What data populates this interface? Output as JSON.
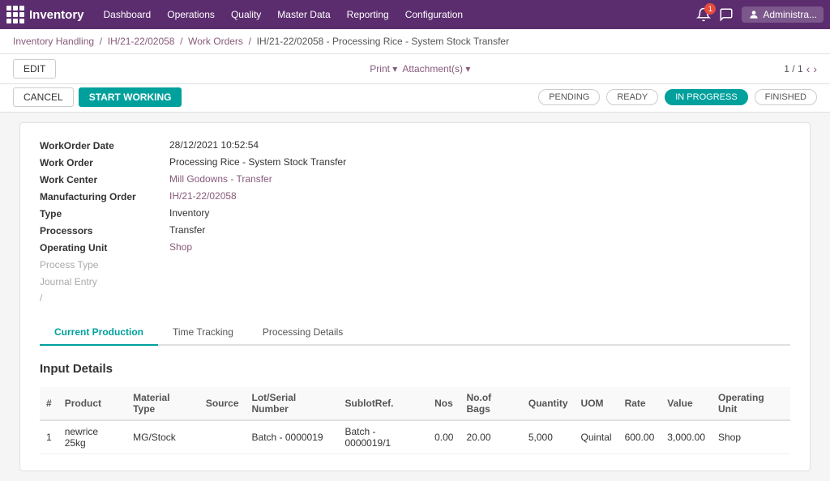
{
  "app": {
    "logo": "Inventory",
    "nav_items": [
      "Dashboard",
      "Operations",
      "Quality",
      "Master Data",
      "Reporting",
      "Configuration"
    ],
    "badge_count": "1",
    "admin_label": "Administra..."
  },
  "breadcrumb": {
    "items": [
      "Inventory Handling",
      "IH/21-22/02058",
      "Work Orders"
    ],
    "current": "IH/21-22/02058 - Processing Rice - System Stock Transfer"
  },
  "toolbar": {
    "edit_label": "EDIT",
    "cancel_label": "CANCEL",
    "start_label": "START WORKING",
    "print_label": "Print ▾",
    "attach_label": "Attachment(s) ▾",
    "counter": "1 / 1"
  },
  "status_pills": [
    {
      "label": "PENDING",
      "active": false
    },
    {
      "label": "READY",
      "active": false
    },
    {
      "label": "IN PROGRESS",
      "active": true
    },
    {
      "label": "FINISHED",
      "active": false
    }
  ],
  "form": {
    "workorder_date_label": "WorkOrder Date",
    "workorder_date_value": "28/12/2021 10:52:54",
    "work_order_label": "Work Order",
    "work_order_value": "Processing Rice - System Stock Transfer",
    "work_center_label": "Work Center",
    "work_center_value": "Mill Godowns - Transfer",
    "manufacturing_order_label": "Manufacturing Order",
    "manufacturing_order_value": "IH/21-22/02058",
    "type_label": "Type",
    "type_value": "Inventory",
    "processors_label": "Processors",
    "processors_value": "Transfer",
    "operating_unit_label": "Operating Unit",
    "operating_unit_value": "Shop",
    "process_type_label": "Process Type",
    "journal_entry_label": "Journal Entry",
    "slash": "/"
  },
  "tabs": [
    {
      "label": "Current Production",
      "active": true
    },
    {
      "label": "Time Tracking",
      "active": false
    },
    {
      "label": "Processing Details",
      "active": false
    }
  ],
  "input_details": {
    "section_title": "Input Details",
    "columns": [
      "#",
      "Product",
      "Material Type",
      "Source",
      "Lot/Serial Number",
      "SublotRef.",
      "Nos",
      "No.of Bags",
      "Quantity",
      "UOM",
      "Rate",
      "Value",
      "Operating Unit"
    ],
    "rows": [
      {
        "num": "1",
        "product": "newrice 25kg",
        "material_type": "MG/Stock",
        "source": "",
        "lot_serial": "Batch - 0000019",
        "sublot_ref": "Batch - 0000019/1",
        "nos": "0.00",
        "no_of_bags": "20.00",
        "quantity": "5,000",
        "uom": "Quintal",
        "rate": "600.00",
        "value": "3,000.00",
        "operating_unit": "Shop"
      }
    ]
  }
}
